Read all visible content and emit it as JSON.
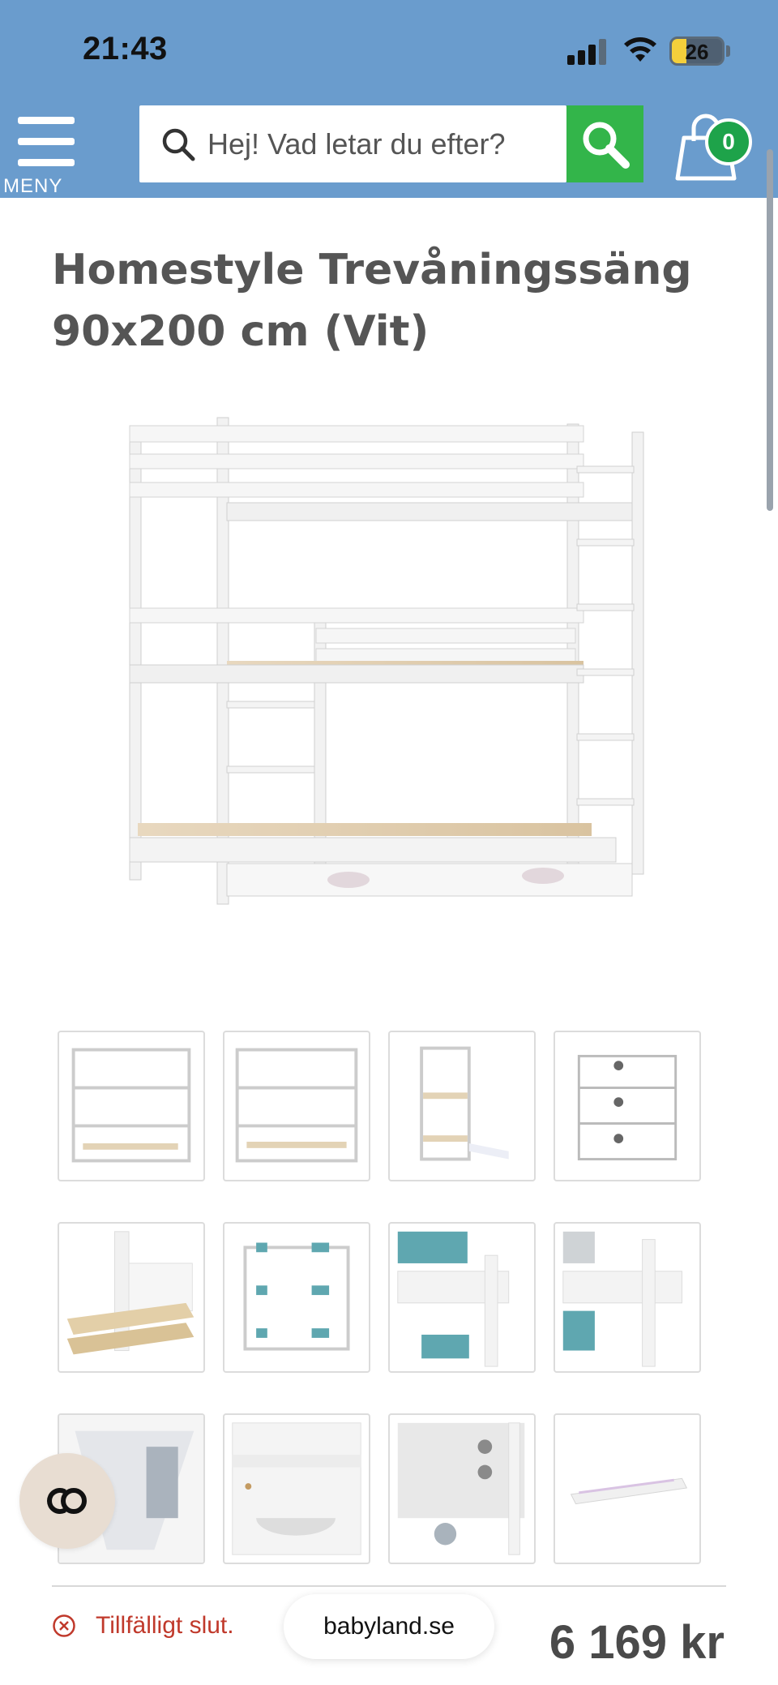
{
  "status_bar": {
    "time": "21:43",
    "battery_level": "26",
    "battery_fraction": 0.26
  },
  "header": {
    "menu_label": "MENY",
    "search_placeholder": "Hej! Vad letar du efter?",
    "cart_count": "0",
    "background_color": "#6a9ccd",
    "search_button_color": "#33b54a"
  },
  "product": {
    "title_line1": "Homestyle Trevåningssäng",
    "title_line2": "90x200 cm (Vit)",
    "thumbnail_count": 12
  },
  "footer": {
    "stock_status": "Tillfälligt slut.",
    "site_url": "babyland.se",
    "price": "6 169 kr"
  },
  "icons": [
    "menu-icon",
    "search-icon",
    "cart-icon",
    "error-circle-icon",
    "chat-icon"
  ]
}
